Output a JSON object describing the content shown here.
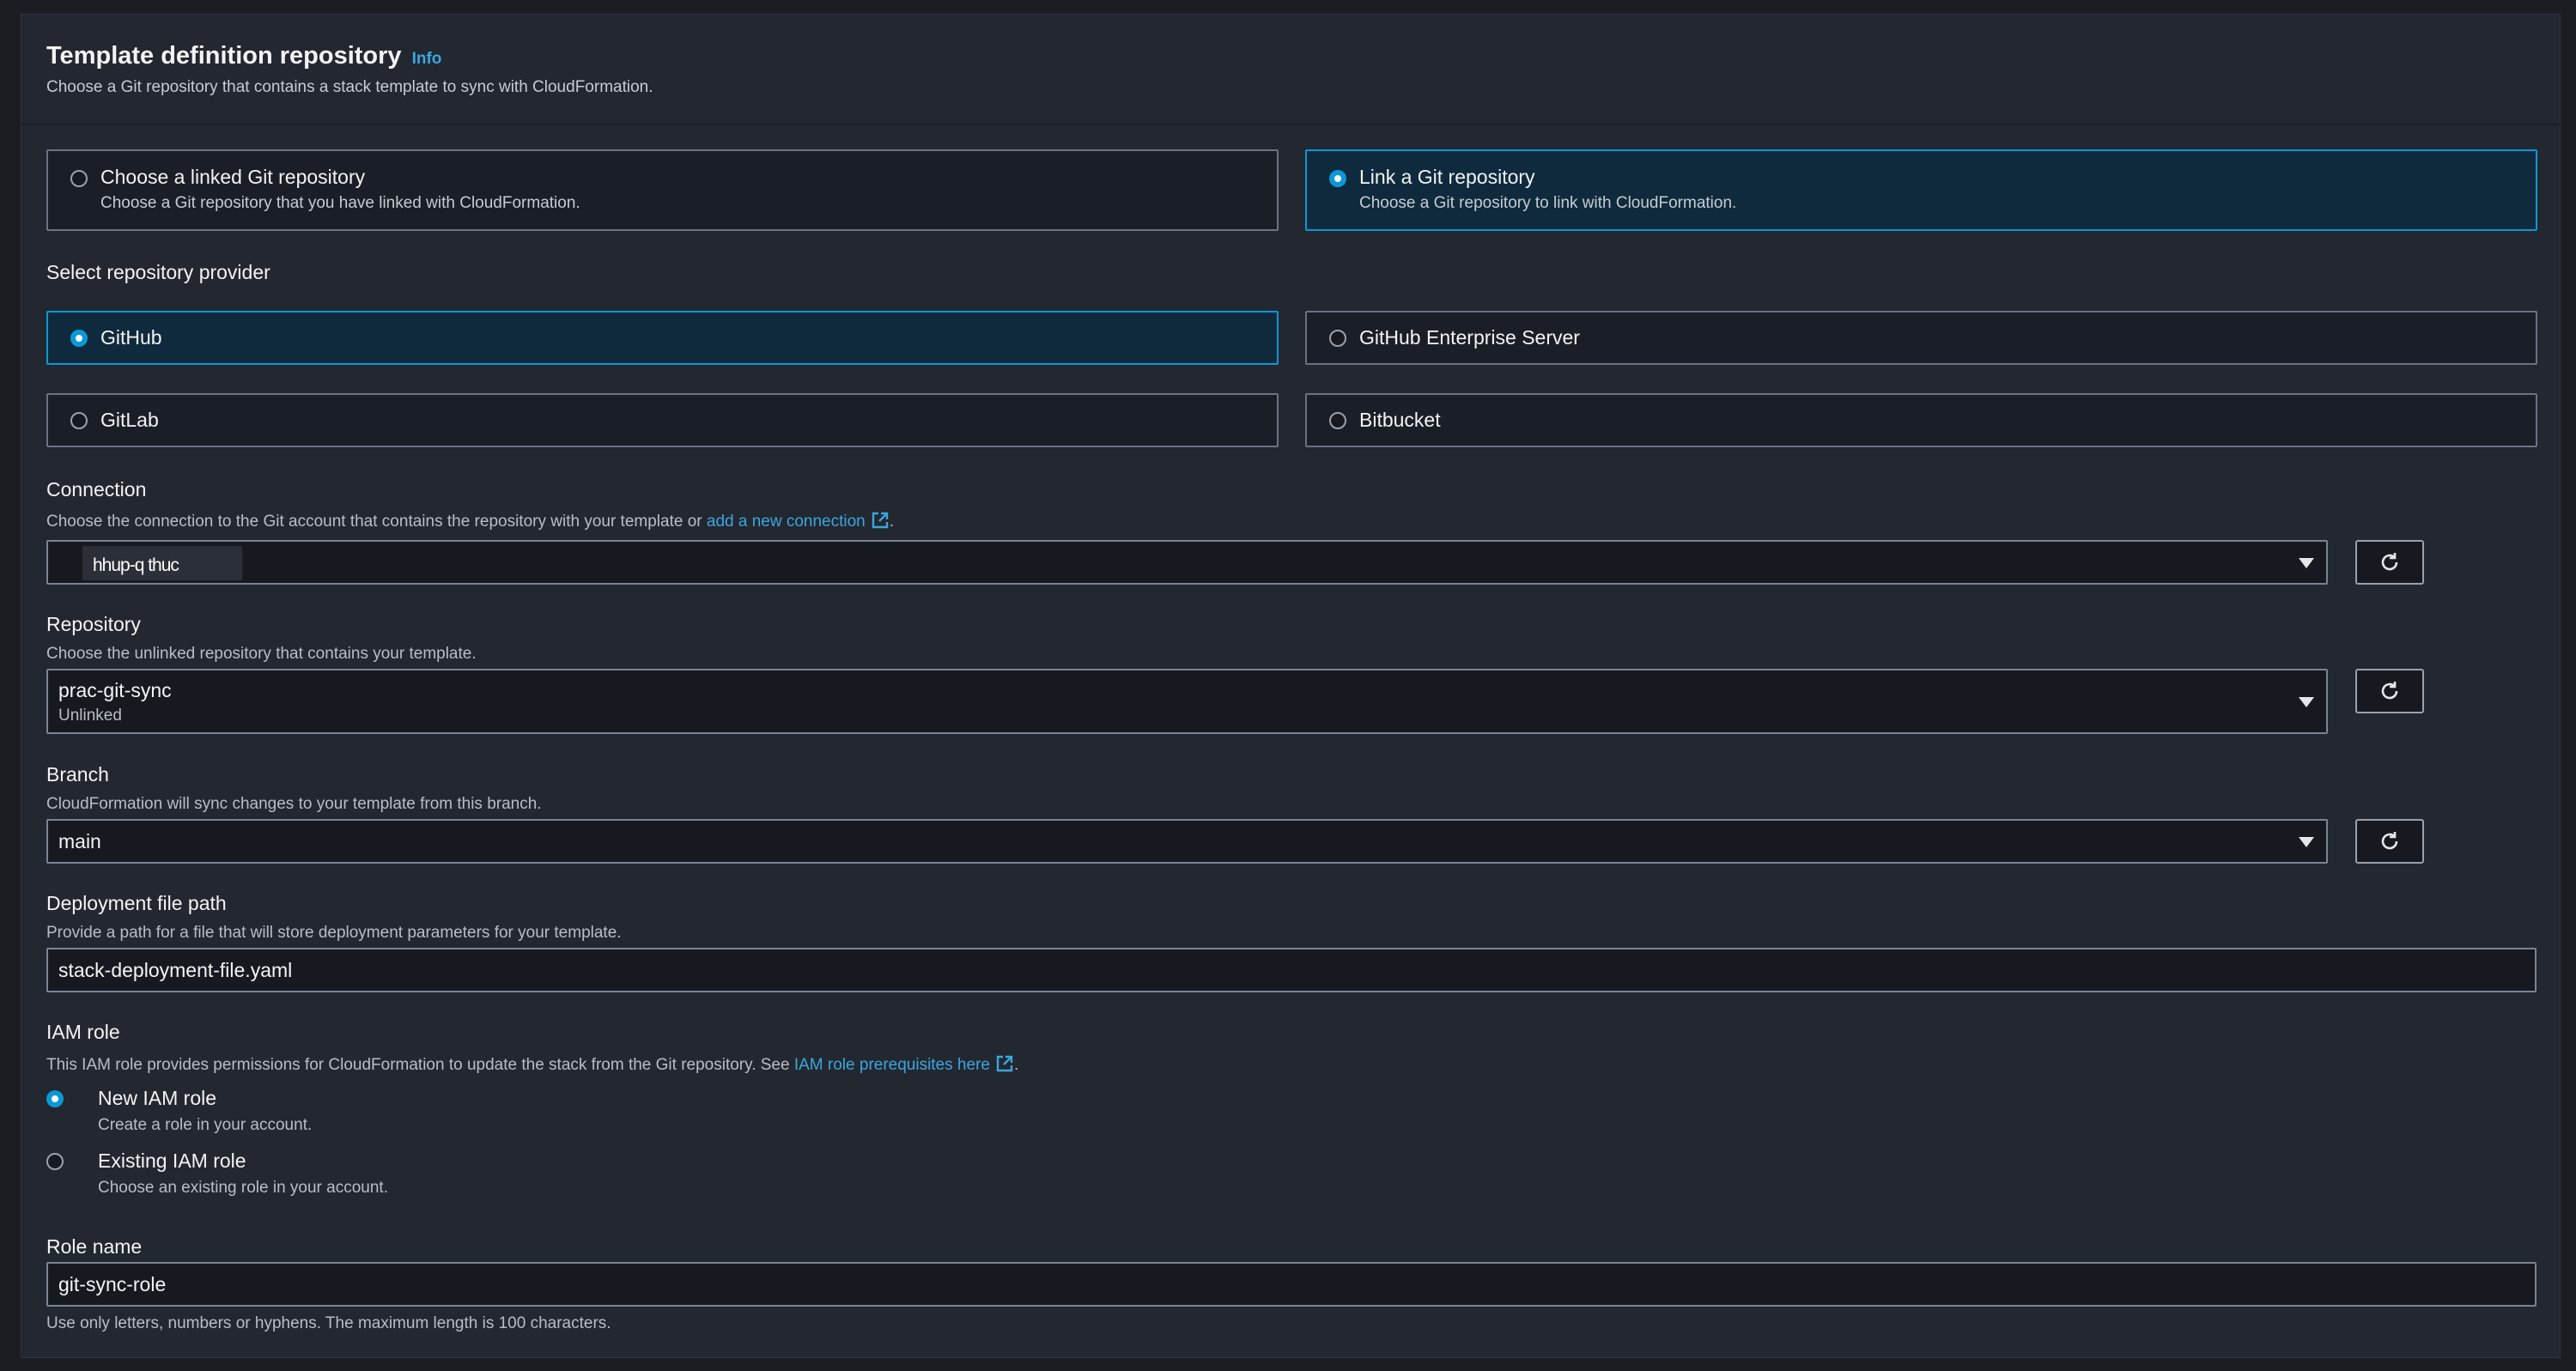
{
  "header": {
    "title": "Template definition repository",
    "info_label": "Info",
    "subtitle": "Choose a Git repository that contains a stack template to sync with CloudFormation."
  },
  "source_options": [
    {
      "label": "Choose a linked Git repository",
      "description": "Choose a Git repository that you have linked with CloudFormation.",
      "selected": false
    },
    {
      "label": "Link a Git repository",
      "description": "Choose a Git repository to link with CloudFormation.",
      "selected": true
    }
  ],
  "provider": {
    "label": "Select repository provider",
    "options": [
      {
        "label": "GitHub",
        "selected": true
      },
      {
        "label": "GitHub Enterprise Server",
        "selected": false
      },
      {
        "label": "GitLab",
        "selected": false
      },
      {
        "label": "Bitbucket",
        "selected": false
      }
    ]
  },
  "connection": {
    "label": "Connection",
    "description": "Choose the connection to the Git account that contains the repository with your template or",
    "link_text": "add a new connection",
    "trailing": ".",
    "value": "hhup-q thuc"
  },
  "repository": {
    "label": "Repository",
    "description": "Choose the unlinked repository that contains your template.",
    "value": "prac-git-sync",
    "status": "Unlinked"
  },
  "branch": {
    "label": "Branch",
    "description": "CloudFormation will sync changes to your template from this branch.",
    "value": "main"
  },
  "deployment_file": {
    "label": "Deployment file path",
    "description": "Provide a path for a file that will store deployment parameters for your template.",
    "value": "stack-deployment-file.yaml"
  },
  "iam_role": {
    "label": "IAM role",
    "description": "This IAM role provides permissions for CloudFormation to update the stack from the Git repository. See",
    "link_text": "IAM role prerequisites here",
    "trailing": ".",
    "options": [
      {
        "label": "New IAM role",
        "description": "Create a role in your account.",
        "selected": true
      },
      {
        "label": "Existing IAM role",
        "description": "Choose an existing role in your account.",
        "selected": false
      }
    ]
  },
  "role_name": {
    "label": "Role name",
    "value": "git-sync-role",
    "constraint": "Use only letters, numbers or hyphens. The maximum length is 100 characters."
  },
  "colors": {
    "accent": "#0a98d6",
    "link": "#39a7e0",
    "panel": "#232730",
    "background": "#1b1d22"
  }
}
